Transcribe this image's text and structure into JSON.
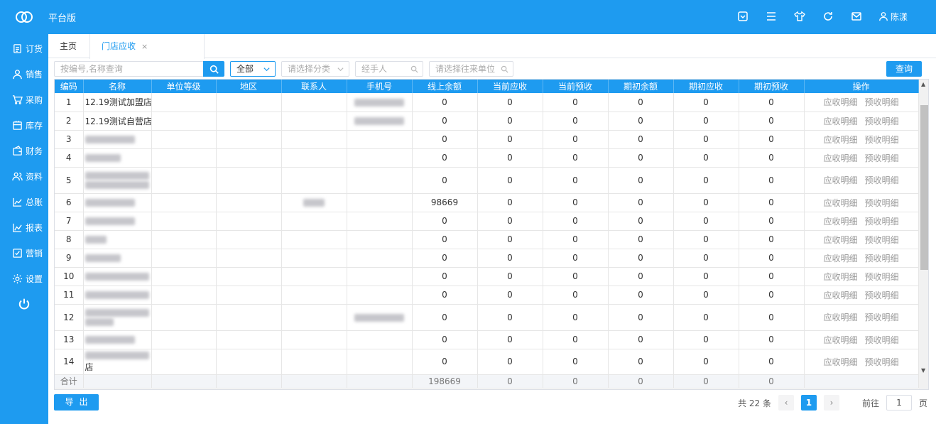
{
  "app": {
    "title": "平台版",
    "user": "陈漾"
  },
  "sidebar": {
    "items": [
      {
        "label": "订货",
        "icon": "order-icon"
      },
      {
        "label": "销售",
        "icon": "user-icon"
      },
      {
        "label": "采购",
        "icon": "cart-icon"
      },
      {
        "label": "库存",
        "icon": "store-icon"
      },
      {
        "label": "财务",
        "icon": "wallet-icon"
      },
      {
        "label": "资料",
        "icon": "people-icon"
      },
      {
        "label": "总账",
        "icon": "chart-icon"
      },
      {
        "label": "报表",
        "icon": "report-icon"
      },
      {
        "label": "营销",
        "icon": "marketing-icon"
      },
      {
        "label": "设置",
        "icon": "gear-icon"
      }
    ]
  },
  "tabs": {
    "home": "主页",
    "active": "门店应收",
    "close": "×"
  },
  "filters": {
    "search_placeholder": "按编号,名称查询",
    "status_value": "全部",
    "category_placeholder": "请选择分类",
    "handler_placeholder": "经手人",
    "partner_placeholder": "请选择往来单位",
    "query_label": "查询"
  },
  "table": {
    "columns": [
      "编码",
      "名称",
      "单位等级",
      "地区",
      "联系人",
      "手机号",
      "线上余额",
      "当前应收",
      "当前预收",
      "期初余额",
      "期初应收",
      "期初预收",
      "操作"
    ],
    "op_receivable": "应收明细",
    "op_prepaid": "预收明细",
    "rows": [
      {
        "id": "1",
        "name": "12.19测试加盟店",
        "online": "0",
        "cur_recv": "0",
        "cur_pre": "0",
        "init_bal": "0",
        "init_recv": "0",
        "init_pre": "0"
      },
      {
        "id": "2",
        "name": "12.19测试自营店",
        "online": "0",
        "cur_recv": "0",
        "cur_pre": "0",
        "init_bal": "0",
        "init_recv": "0",
        "init_pre": "0"
      },
      {
        "id": "3",
        "name": "",
        "online": "0",
        "cur_recv": "0",
        "cur_pre": "0",
        "init_bal": "0",
        "init_recv": "0",
        "init_pre": "0"
      },
      {
        "id": "4",
        "name": "",
        "online": "0",
        "cur_recv": "0",
        "cur_pre": "0",
        "init_bal": "0",
        "init_recv": "0",
        "init_pre": "0"
      },
      {
        "id": "5",
        "name": "",
        "online": "0",
        "cur_recv": "0",
        "cur_pre": "0",
        "init_bal": "0",
        "init_recv": "0",
        "init_pre": "0"
      },
      {
        "id": "6",
        "name": "",
        "online": "98669",
        "cur_recv": "0",
        "cur_pre": "0",
        "init_bal": "0",
        "init_recv": "0",
        "init_pre": "0"
      },
      {
        "id": "7",
        "name": "",
        "online": "0",
        "cur_recv": "0",
        "cur_pre": "0",
        "init_bal": "0",
        "init_recv": "0",
        "init_pre": "0"
      },
      {
        "id": "8",
        "name": "",
        "online": "0",
        "cur_recv": "0",
        "cur_pre": "0",
        "init_bal": "0",
        "init_recv": "0",
        "init_pre": "0"
      },
      {
        "id": "9",
        "name": "",
        "online": "0",
        "cur_recv": "0",
        "cur_pre": "0",
        "init_bal": "0",
        "init_recv": "0",
        "init_pre": "0"
      },
      {
        "id": "10",
        "name": "",
        "online": "0",
        "cur_recv": "0",
        "cur_pre": "0",
        "init_bal": "0",
        "init_recv": "0",
        "init_pre": "0"
      },
      {
        "id": "11",
        "name": "",
        "online": "0",
        "cur_recv": "0",
        "cur_pre": "0",
        "init_bal": "0",
        "init_recv": "0",
        "init_pre": "0"
      },
      {
        "id": "12",
        "name": "",
        "online": "0",
        "cur_recv": "0",
        "cur_pre": "0",
        "init_bal": "0",
        "init_recv": "0",
        "init_pre": "0"
      },
      {
        "id": "13",
        "name": "",
        "online": "0",
        "cur_recv": "0",
        "cur_pre": "0",
        "init_bal": "0",
        "init_recv": "0",
        "init_pre": "0"
      },
      {
        "id": "14",
        "name": "店",
        "online": "0",
        "cur_recv": "0",
        "cur_pre": "0",
        "init_bal": "0",
        "init_recv": "0",
        "init_pre": "0"
      }
    ],
    "total": {
      "label": "合计",
      "online": "198669",
      "cur_recv": "0",
      "cur_pre": "0",
      "init_bal": "0",
      "init_recv": "0",
      "init_pre": "0"
    }
  },
  "footer": {
    "export_label": "导出",
    "total_text": "共 22 条",
    "current_page": "1",
    "goto_label": "前往",
    "goto_value": "1",
    "page_unit": "页"
  },
  "colors": {
    "primary": "#1e9bf0"
  }
}
